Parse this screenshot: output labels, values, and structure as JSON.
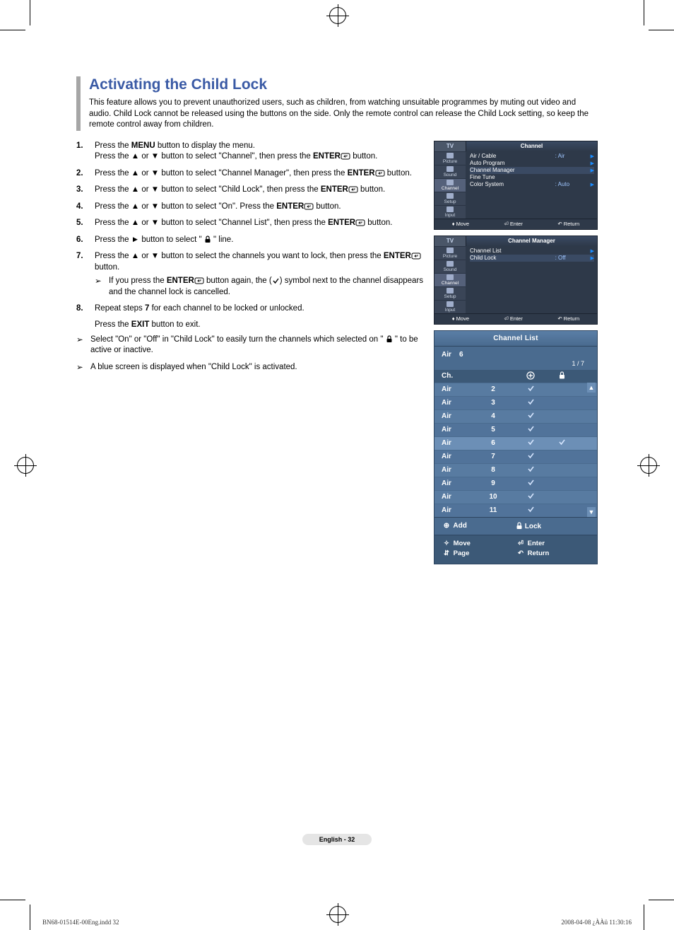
{
  "heading": "Activating the Child Lock",
  "intro": "This feature allows you to prevent unauthorized users, such as children, from watching unsuitable programmes by muting out video and audio. Child Lock cannot be released using the buttons on the side. Only the remote control can release the Child Lock setting, so keep the remote control away from children.",
  "steps": [
    {
      "num": "1.",
      "a": "Press the ",
      "b": "MENU",
      "c": " button to display the menu.",
      "line2a": "Press the ▲ or ▼ button to   select \"Channel\", then press the ",
      "line2b": "ENTER",
      "line2c": " button."
    },
    {
      "num": "2.",
      "a": "Press the ▲ or ▼ button to select \"Channel Manager\", then press the ",
      "b": "ENTER",
      "c": " button."
    },
    {
      "num": "3.",
      "a": "Press the ▲ or ▼ button to select \"Child Lock\", then press the ",
      "b": "ENTER",
      "c": " button."
    },
    {
      "num": "4.",
      "a": "Press the ▲ or ▼ button to select \"On\". Press the ",
      "b": "ENTER",
      "c": " button."
    },
    {
      "num": "5.",
      "a": "Press the ▲ or ▼ button to select \"Channel List\", then press the ",
      "b": "ENTER",
      "c": " button."
    },
    {
      "num": "6.",
      "a": "Press the ► button to select \" ",
      "c": " \" line."
    },
    {
      "num": "7.",
      "a": "Press the ▲ or ▼ button to select the channels you want to lock, then press the ",
      "b": "ENTER",
      "c": " button.",
      "sub_a": "If you press the ",
      "sub_b": "ENTER",
      "sub_c": " button again, the (",
      "sub_d": ") symbol next to the channel disappears and the channel lock is cancelled."
    },
    {
      "num": "8.",
      "a": "Repeat steps ",
      "b": "7",
      "c": " for each channel to be locked or unlocked."
    }
  ],
  "exit_a": "Press the ",
  "exit_b": "EXIT",
  "exit_c": " button to exit.",
  "note1_a": "Select \"On\" or \"Off\" in \"Child Lock\" to easily turn the channels which selected on \" ",
  "note1_c": " \" to be active or inactive.",
  "note2": "A blue screen is displayed when \"Child Lock\" is activated.",
  "osd1": {
    "tv": "TV",
    "title": "Channel",
    "side": [
      "Picture",
      "Sound",
      "Channel",
      "Setup",
      "Input"
    ],
    "rows": [
      {
        "k": "Air / Cable",
        "v": ": Air"
      },
      {
        "k": "Auto Program",
        "v": ""
      },
      {
        "k": "Channel Manager",
        "v": "",
        "hl": true
      },
      {
        "k": "Fine Tune",
        "v": ""
      },
      {
        "k": "Color System",
        "v": ": Auto"
      }
    ],
    "foot": [
      "Move",
      "Enter",
      "Return"
    ]
  },
  "osd2": {
    "tv": "TV",
    "title": "Channel Manager",
    "side": [
      "Picture",
      "Sound",
      "Channel",
      "Setup",
      "Input"
    ],
    "rows": [
      {
        "k": "Channel List",
        "v": ""
      },
      {
        "k": "Child Lock",
        "v": ": Off",
        "hl": true
      }
    ],
    "foot": [
      "Move",
      "Enter",
      "Return"
    ]
  },
  "chlist": {
    "title": "Channel List",
    "sub_air": "Air",
    "sub_num": "6",
    "pager": "1 / 7",
    "hdr": {
      "c1": "Ch."
    },
    "rows": [
      {
        "air": "Air",
        "n": "2",
        "add": "✓",
        "lock": ""
      },
      {
        "air": "Air",
        "n": "3",
        "add": "✓",
        "lock": ""
      },
      {
        "air": "Air",
        "n": "4",
        "add": "✓",
        "lock": ""
      },
      {
        "air": "Air",
        "n": "5",
        "add": "✓",
        "lock": ""
      },
      {
        "air": "Air",
        "n": "6",
        "add": "✓",
        "lock": "✓",
        "sel": true
      },
      {
        "air": "Air",
        "n": "7",
        "add": "✓",
        "lock": ""
      },
      {
        "air": "Air",
        "n": "8",
        "add": "✓",
        "lock": ""
      },
      {
        "air": "Air",
        "n": "9",
        "add": "✓",
        "lock": ""
      },
      {
        "air": "Air",
        "n": "10",
        "add": "✓",
        "lock": ""
      },
      {
        "air": "Air",
        "n": "11",
        "add": "✓",
        "lock": ""
      }
    ],
    "actions": {
      "add": "Add",
      "lock": "Lock"
    },
    "foot": {
      "move": "Move",
      "enter": "Enter",
      "page": "Page",
      "ret": "Return"
    }
  },
  "page_num": "English - 32",
  "print_left": "BN68-01514E-00Eng.indd   32",
  "print_right": "2008-04-08   ¿ÀÀü 11:30:16"
}
